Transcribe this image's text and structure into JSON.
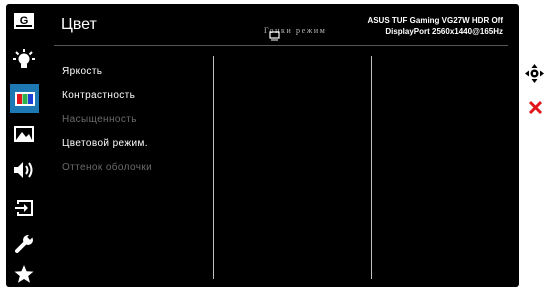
{
  "sidebar": {
    "items": [
      {
        "name": "logo",
        "label": "G",
        "icon": "asus-gaming-logo"
      },
      {
        "name": "splendid",
        "icon": "sun-bulb-icon"
      },
      {
        "name": "color",
        "icon": "color-bars-icon",
        "selected": true
      },
      {
        "name": "image",
        "icon": "landscape-image-icon"
      },
      {
        "name": "sound",
        "icon": "speaker-icon"
      },
      {
        "name": "input-select",
        "icon": "input-select-icon"
      },
      {
        "name": "system-setup",
        "icon": "wrench-icon"
      },
      {
        "name": "my-favorite",
        "icon": "star-icon"
      }
    ]
  },
  "header": {
    "title": "Цвет",
    "model_line": "ASUS TUF Gaming   VG27W HDR Off",
    "preset": "Гонки режим",
    "input_info": "DisplayPort 2560x1440@165Hz"
  },
  "menu": {
    "items": [
      {
        "label": "Яркость",
        "enabled": true
      },
      {
        "label": "Контрастность",
        "enabled": true
      },
      {
        "label": "Насыщенность",
        "enabled": false
      },
      {
        "label": "Цветовой режим.",
        "enabled": true
      },
      {
        "label": "Оттенок оболочки",
        "enabled": false
      }
    ]
  },
  "nav": {
    "joystick_icon": "joystick-icon",
    "exit_icon": "close-x-icon"
  },
  "colors": {
    "selection": "#1e78b4",
    "exit": "#e0161b",
    "background": "#000000",
    "text": "#ffffff",
    "disabled_text": "#6b6b6b"
  }
}
